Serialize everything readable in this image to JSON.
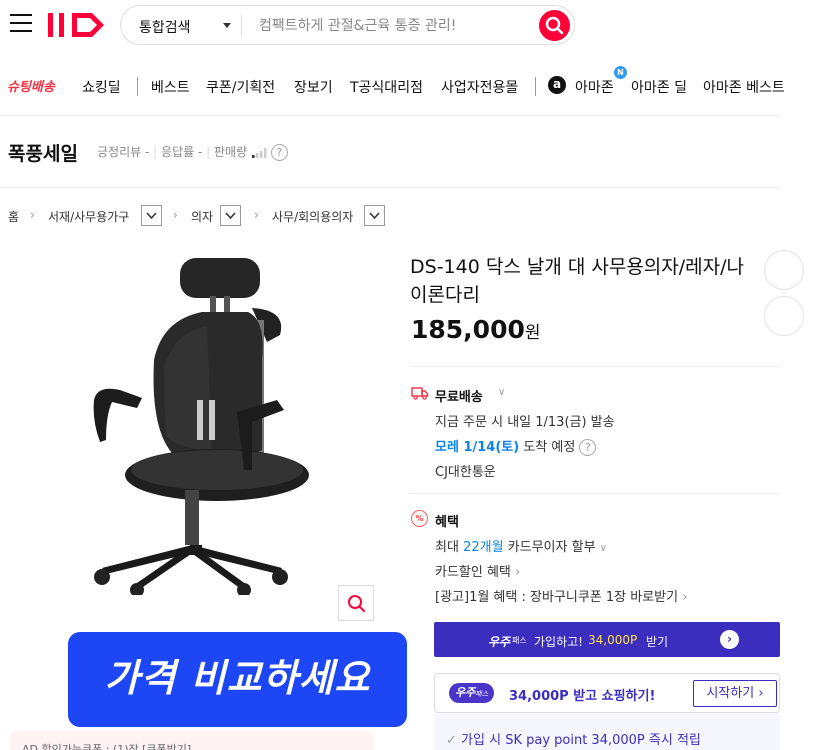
{
  "header": {
    "search_scope": "통합검색",
    "search_placeholder": "컴팩트하게 관절&근육 통증 관리!"
  },
  "nav": {
    "shooting_delivery": "슈팅배송",
    "items": [
      "쇼킹딜",
      "베스트",
      "쿠폰/기획전",
      "장보기",
      "T공식대리점",
      "사업자전용몰"
    ],
    "amazon_badge": "N",
    "amazon_items": [
      "아마존",
      "아마존 딜",
      "아마존 베스트"
    ]
  },
  "storm_sale": {
    "title": "폭풍세일",
    "review_label": "긍정리뷰",
    "review_value": "-",
    "response_label": "응답률",
    "response_value": "-",
    "sales_label": "판매량"
  },
  "breadcrumb": {
    "home": "홈",
    "levels": [
      "서재/사무용가구",
      "의자",
      "사무/회의용의자"
    ]
  },
  "product": {
    "title": "DS-140 닥스 날개 대 사무용의자/레자/나이론다리",
    "price": "185,000",
    "currency": "원"
  },
  "banner_text": "가격 비교하세요",
  "coupon_strip": "AD   할인가능쿠폰 : (1)장 [쿠폰받기]",
  "shipping": {
    "title": "무료배송",
    "line1": "지금 주문 시 내일 1/13(금) 발송",
    "arrival_date": "모레 1/14(토)",
    "arrival_suffix": "도착 예정",
    "carrier": "CJ대한통운"
  },
  "benefit": {
    "icon_text": "%",
    "title": "혜택",
    "installment_prefix": "최대",
    "installment_months": "22개월",
    "installment_suffix": "카드무이자 할부",
    "card_discount": "카드할인 혜택",
    "ad_coupon": "[광고]1월 혜택 : 장바구니쿠폰 1장 바로받기"
  },
  "wooju_banner": {
    "logo": "우주",
    "pass": "패스",
    "text": "가입하고!",
    "points": "34,000P",
    "suffix": "받기"
  },
  "wooju_box": {
    "logo": "우주",
    "pass": "패스",
    "text": "34,000P 받고 쇼핑하기!",
    "button": "시작하기"
  },
  "skpay": "가입 시 SK pay point 34,000P 즉시 적립",
  "colors": {
    "brand_red": "#ff0038",
    "banner_blue": "#1d46f5",
    "wooju_purple": "#3b2dbd",
    "link_blue": "#0b83e6"
  }
}
